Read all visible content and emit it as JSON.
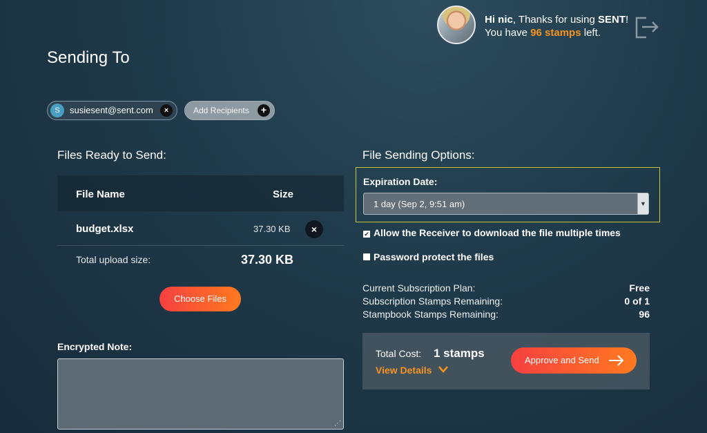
{
  "header": {
    "greeting_prefix": "Hi ",
    "user_name": "nic",
    "greeting_mid": ", Thanks for using ",
    "brand": "SENT",
    "greeting_end": "!",
    "stamps_prefix": "You have ",
    "stamps_count": "96 stamps",
    "stamps_suffix": " left."
  },
  "page_title": "Sending To",
  "recipients": [
    {
      "initial": "S",
      "email": "susiesent@sent.com",
      "remove": "×"
    }
  ],
  "add_recipients": {
    "label": "Add Recipients",
    "icon": "+"
  },
  "files": {
    "section_title": "Files Ready to Send:",
    "columns": {
      "name": "File Name",
      "size": "Size"
    },
    "rows": [
      {
        "name": "budget.xlsx",
        "size": "37.30 KB",
        "remove": "×"
      }
    ],
    "total_label": "Total upload size:",
    "total_value": "37.30 KB",
    "choose_button": "Choose Files"
  },
  "note": {
    "label": "Encrypted Note:",
    "value": ""
  },
  "options": {
    "section_title": "File Sending Options:",
    "expiration_label": "Expiration Date:",
    "expiration_value": "1 day (Sep 2, 9:51 am)",
    "allow_multiple": {
      "label": "Allow the Receiver to download the file multiple times",
      "checked": true
    },
    "password_protect": {
      "label": "Password protect the files",
      "checked": false
    }
  },
  "plan": {
    "rows": [
      {
        "label": "Current Subscription Plan:",
        "value": "Free"
      },
      {
        "label": "Subscription Stamps Remaining:",
        "value": "0 of 1"
      },
      {
        "label": "Stampbook Stamps Remaining:",
        "value": "96"
      }
    ]
  },
  "cost": {
    "label": "Total Cost:",
    "value": "1 stamps",
    "details": "View Details",
    "approve_button": "Approve and Send"
  },
  "colors": {
    "accent_orange": "#f7931e",
    "button_gradient_start": "#f64040",
    "button_gradient_end": "#ff7a1f",
    "highlight_border": "#c9c63b"
  }
}
